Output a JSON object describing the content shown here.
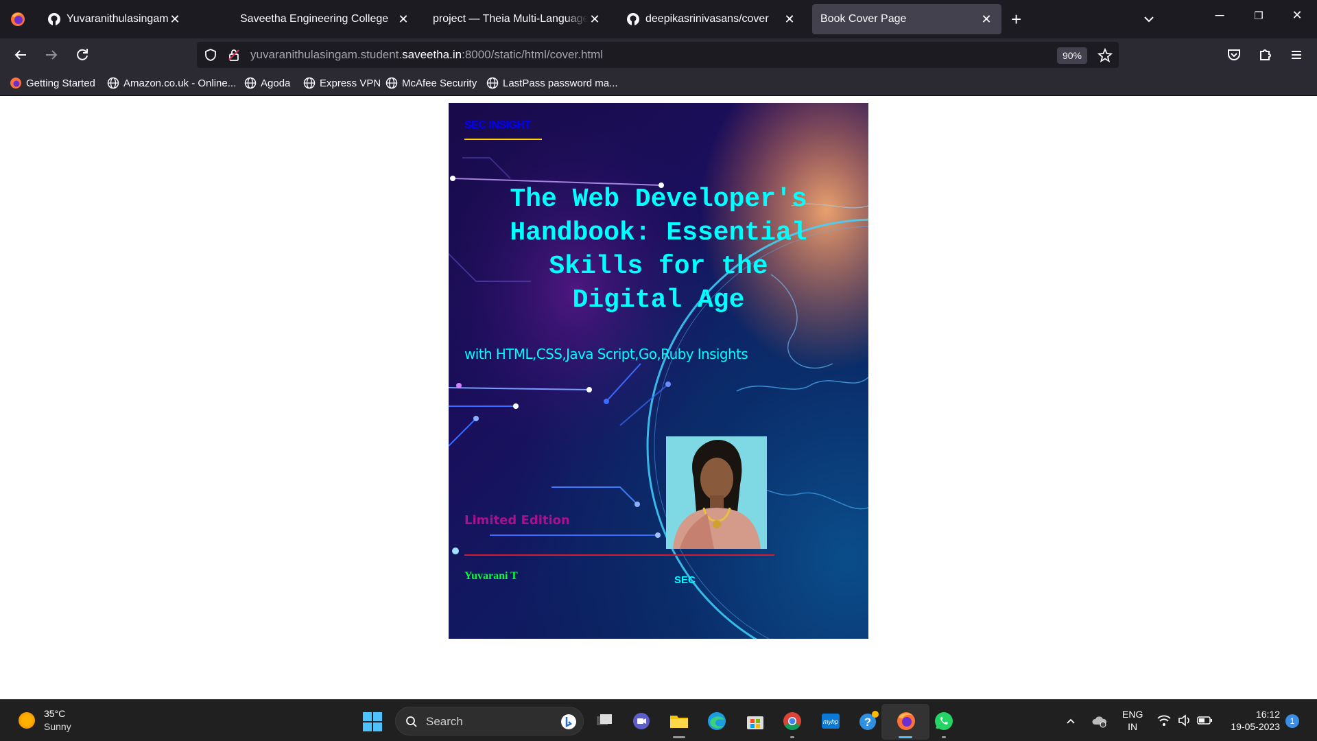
{
  "browser": {
    "tabs": [
      {
        "title": "Yuvaranithulasingam/cover",
        "icon": "github-icon"
      },
      {
        "title": "Saveetha Engineering College",
        "icon": "none"
      },
      {
        "title": "project — Theia Multi-Language Ex",
        "icon": "none"
      },
      {
        "title": "deepikasrinivasans/cover",
        "icon": "github-icon"
      },
      {
        "title": "Book Cover Page",
        "icon": "none",
        "active": true
      }
    ],
    "url_prefix": "yuvaranithulasingam.student.",
    "url_domain": "saveetha.in",
    "url_suffix": ":8000/static/html/cover.html",
    "zoom": "90%",
    "bookmarks": [
      {
        "label": "Getting Started",
        "icon": "firefox-icon"
      },
      {
        "label": "Amazon.co.uk - Online...",
        "icon": "globe-icon"
      },
      {
        "label": "Agoda",
        "icon": "globe-icon"
      },
      {
        "label": "Express VPN",
        "icon": "globe-icon"
      },
      {
        "label": "McAfee Security",
        "icon": "globe-icon"
      },
      {
        "label": "LastPass password ma...",
        "icon": "globe-icon"
      }
    ]
  },
  "cover": {
    "brand": "SEC INSIGHT",
    "title_lines": [
      "The Web Developer's",
      "Handbook: Essential",
      "Skills for the",
      "Digital Age"
    ],
    "subtitle": "with HTML,CSS,Java Script,Go,Ruby Insights",
    "edition": "Limited Edition",
    "author": "Yuvarani T",
    "publisher": "SEC",
    "colors": {
      "brand": "#0000ff",
      "title": "#00ffff",
      "edition": "#a8128c",
      "author": "#00ff33",
      "rule": "#d21b2c",
      "brand_underline": "#ffd400"
    }
  },
  "taskbar": {
    "weather_temp": "35°C",
    "weather_cond": "Sunny",
    "search_placeholder": "Search",
    "lang_top": "ENG",
    "lang_bottom": "IN",
    "time": "16:12",
    "date": "19-05-2023",
    "notification_count": "1"
  }
}
